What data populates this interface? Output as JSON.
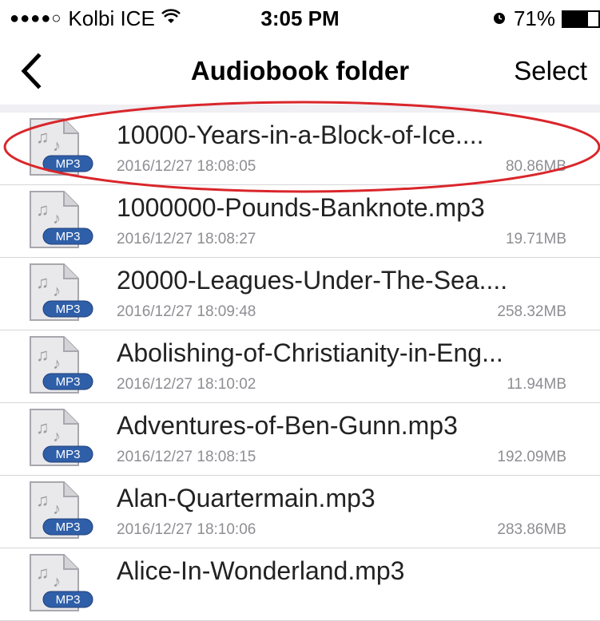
{
  "status_bar": {
    "carrier": "Kolbi ICE",
    "time": "3:05 PM",
    "battery_percent_label": "71%",
    "battery_level": 0.71,
    "signal_icon": "signal-dots-icon",
    "wifi_icon": "wifi-icon",
    "alarm_icon": "alarm-clock-icon"
  },
  "nav": {
    "title": "Audiobook folder",
    "select_label": "Select",
    "back_icon": "chevron-left-icon"
  },
  "file_icon_badge": "MP3",
  "files": [
    {
      "name": "10000-Years-in-a-Block-of-Ice....",
      "date": "2016/12/27 18:08:05",
      "size": "80.86MB"
    },
    {
      "name": "1000000-Pounds-Banknote.mp3",
      "date": "2016/12/27 18:08:27",
      "size": "19.71MB"
    },
    {
      "name": "20000-Leagues-Under-The-Sea....",
      "date": "2016/12/27 18:09:48",
      "size": "258.32MB"
    },
    {
      "name": "Abolishing-of-Christianity-in-Eng...",
      "date": "2016/12/27 18:10:02",
      "size": "11.94MB"
    },
    {
      "name": "Adventures-of-Ben-Gunn.mp3",
      "date": "2016/12/27 18:08:15",
      "size": "192.09MB"
    },
    {
      "name": "Alan-Quartermain.mp3",
      "date": "2016/12/27 18:10:06",
      "size": "283.86MB"
    },
    {
      "name": "Alice-In-Wonderland.mp3",
      "date": "",
      "size": ""
    }
  ],
  "colors": {
    "annotation": "#d9262b",
    "badge": "#2f5fa8",
    "separator": "#d6d6da",
    "secondary_text": "#8e8e93"
  }
}
